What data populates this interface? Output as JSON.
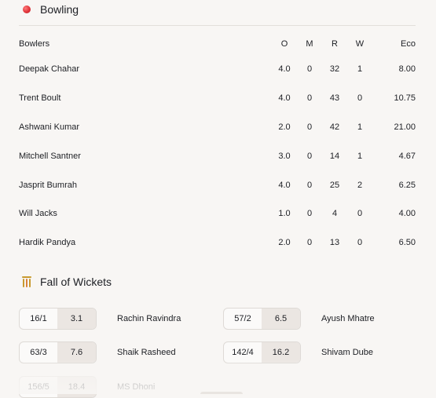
{
  "bowling": {
    "title": "Bowling",
    "headers": {
      "bowlers": "Bowlers",
      "o": "O",
      "m": "M",
      "r": "R",
      "w": "W",
      "eco": "Eco"
    },
    "rows": [
      {
        "name": "Deepak Chahar",
        "o": "4.0",
        "m": "0",
        "r": "32",
        "w": "1",
        "eco": "8.00"
      },
      {
        "name": "Trent Boult",
        "o": "4.0",
        "m": "0",
        "r": "43",
        "w": "0",
        "eco": "10.75"
      },
      {
        "name": "Ashwani Kumar",
        "o": "2.0",
        "m": "0",
        "r": "42",
        "w": "1",
        "eco": "21.00"
      },
      {
        "name": "Mitchell Santner",
        "o": "3.0",
        "m": "0",
        "r": "14",
        "w": "1",
        "eco": "4.67"
      },
      {
        "name": "Jasprit Bumrah",
        "o": "4.0",
        "m": "0",
        "r": "25",
        "w": "2",
        "eco": "6.25"
      },
      {
        "name": "Will Jacks",
        "o": "1.0",
        "m": "0",
        "r": "4",
        "w": "0",
        "eco": "4.00"
      },
      {
        "name": "Hardik Pandya",
        "o": "2.0",
        "m": "0",
        "r": "13",
        "w": "0",
        "eco": "6.50"
      }
    ]
  },
  "fall_of_wickets": {
    "title": "Fall of Wickets",
    "items": [
      {
        "score": "16/1",
        "over": "3.1",
        "player": "Rachin Ravindra"
      },
      {
        "score": "57/2",
        "over": "6.5",
        "player": "Ayush Mhatre"
      },
      {
        "score": "63/3",
        "over": "7.6",
        "player": "Shaik Rasheed"
      },
      {
        "score": "142/4",
        "over": "16.2",
        "player": "Shivam Dube"
      },
      {
        "score": "156/5",
        "over": "18.4",
        "player": "MS Dhoni"
      }
    ]
  },
  "colors": {
    "accent_ball": "#e0343a",
    "wicket_icon": "#c89a2f",
    "background": "#f8f6f4"
  },
  "icons": {
    "bowling": "cricket-ball-icon",
    "fow": "wickets-icon"
  }
}
